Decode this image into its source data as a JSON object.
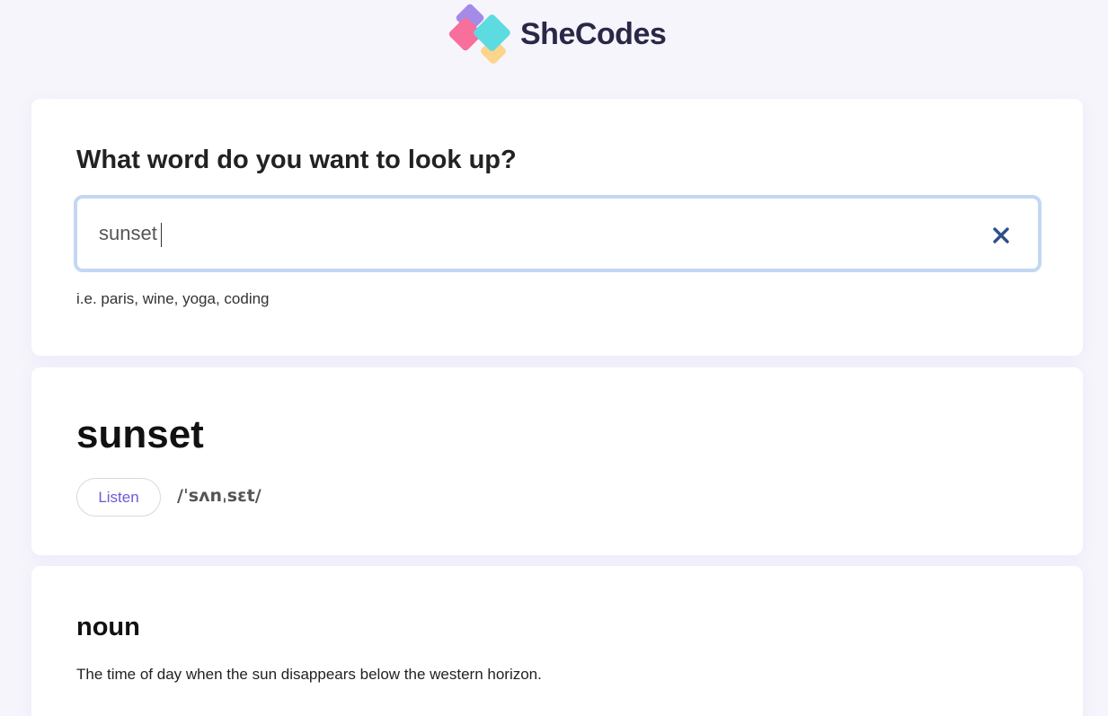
{
  "brand": {
    "name": "SheCodes",
    "colors": {
      "purple": "#a58be8",
      "pink": "#f76f9a",
      "teal": "#5cdce0",
      "yellow": "#fcd58a",
      "text": "#2a2847"
    }
  },
  "search": {
    "question": "What word do you want to look up?",
    "value": "sunset",
    "clear_icon": "close-icon",
    "hint": "i.e. paris, wine, yoga, coding"
  },
  "result": {
    "word": "sunset",
    "listen_label": "Listen",
    "phonetic": "/ˈsʌnˌsɛt/"
  },
  "meanings": [
    {
      "part_of_speech": "noun",
      "definition": "The time of day when the sun disappears below the western horizon."
    }
  ],
  "accent": {
    "link": "#6b5bd6",
    "focus_border": "#c4d7f2",
    "clear_icon": "#2d4f8a"
  }
}
